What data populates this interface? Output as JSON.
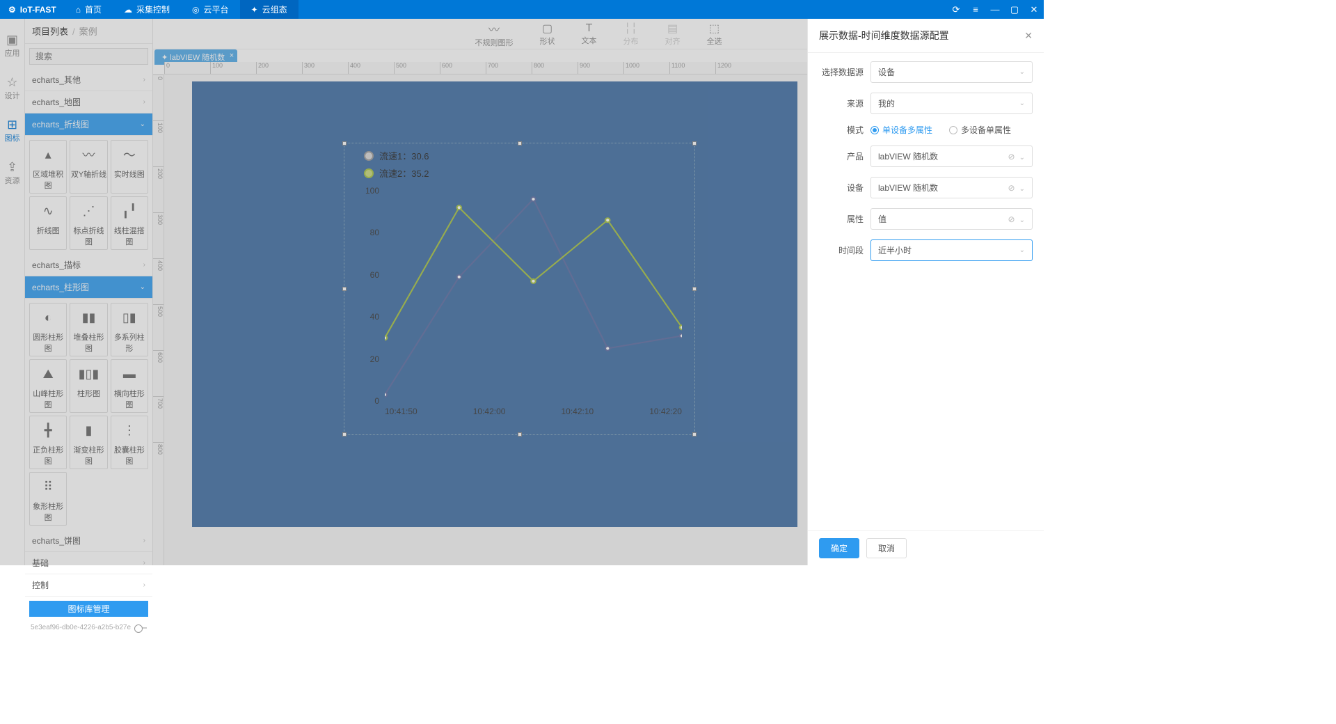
{
  "app": {
    "name": "IoT-FAST"
  },
  "nav": {
    "home": "首页",
    "collect": "采集控制",
    "cloud": "云平台",
    "config": "云组态"
  },
  "breadcrumb": {
    "root": "项目列表",
    "sub": "案例"
  },
  "search": {
    "placeholder": "搜索"
  },
  "lefttabs": {
    "app": "应用",
    "design": "设计",
    "icon": "图标",
    "resource": "资源"
  },
  "groups": {
    "other": "echarts_其他",
    "map": "echarts_地图",
    "line": "echarts_折线图",
    "gauge": "echarts_描标",
    "bar": "echarts_柱形图",
    "pie": "echarts_饼图",
    "basic": "基础",
    "control": "控制"
  },
  "thumbs_line": [
    "区域堆积图",
    "双Y轴折线",
    "实时线图",
    "折线图",
    "标点折线图",
    "线柱混搭图"
  ],
  "thumbs_bar": [
    "圆形柱形图",
    "堆叠柱形图",
    "多系列柱形",
    "山峰柱形图",
    "柱形图",
    "横向柱形图",
    "正负柱形图",
    "渐变柱形图",
    "胶囊柱形图",
    "象形柱形图"
  ],
  "iconlib": "图标库管理",
  "guid": "5e3eaf96-db0e-4226-a2b5-b27e",
  "toolbar": {
    "irregular": "不规则图形",
    "shape": "形状",
    "text": "文本",
    "distribute": "分布",
    "align": "对齐",
    "selectall": "全选"
  },
  "tab": {
    "label": "labVIEW 随机数"
  },
  "ruler_h": [
    "0",
    "100",
    "200",
    "300",
    "400",
    "500",
    "600",
    "700",
    "800",
    "900",
    "1000",
    "1100",
    "1200"
  ],
  "ruler_v": [
    "0",
    "100",
    "200",
    "300",
    "400",
    "500",
    "600",
    "700",
    "800"
  ],
  "chart_data": {
    "type": "line",
    "x": [
      "10:41:50",
      "10:42:00",
      "10:42:10",
      "10:42:20"
    ],
    "series": [
      {
        "name": "流速1",
        "legend": "流速1：30.6",
        "color": "#5b6aa0",
        "values": [
          3,
          59,
          96,
          25,
          31
        ]
      },
      {
        "name": "流速2",
        "legend": "流速2：35.2",
        "color": "#a6c23d",
        "values": [
          30,
          92,
          57,
          86,
          35
        ]
      }
    ],
    "ylim": [
      0,
      100
    ],
    "yticks": [
      0,
      20,
      40,
      60,
      80,
      100
    ]
  },
  "panel": {
    "title": "展示数据-时间维度数据源配置",
    "fields": {
      "datasource_l": "选择数据源",
      "datasource_v": "设备",
      "source_l": "来源",
      "source_v": "我的",
      "mode_l": "模式",
      "mode_a": "单设备多属性",
      "mode_b": "多设备单属性",
      "product_l": "产品",
      "product_v": "labVIEW 随机数",
      "device_l": "设备",
      "device_v": "labVIEW 随机数",
      "attr_l": "属性",
      "attr_v": "值",
      "period_l": "时间段",
      "period_v": "近半小时"
    },
    "ok": "确定",
    "cancel": "取消"
  }
}
